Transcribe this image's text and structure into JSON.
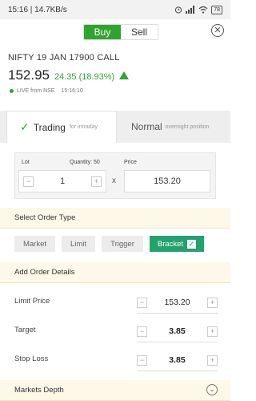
{
  "status_bar": {
    "time_speed": "15:16 | 14.7KB/s",
    "battery": "78"
  },
  "toggle": {
    "buy_label": "Buy",
    "sell_label": "Sell"
  },
  "instrument": {
    "name": "NIFTY 19 JAN 17900 CALL",
    "ltp": "152.95",
    "change": "24.35 (18.93%)",
    "live_label": "LIVE from NSE",
    "live_time": "15:16:10",
    "change_color": "#2fa52f"
  },
  "tabs": {
    "trading": {
      "title": "Trading",
      "sub": "for intraday"
    },
    "normal": {
      "title": "Normal",
      "sub": "overnight position"
    }
  },
  "order": {
    "lot_label": "Lot",
    "quantity_label": "Quantity: 50",
    "price_label": "Price",
    "lot_value": "1",
    "price_value": "153.20",
    "times": "x"
  },
  "order_type": {
    "heading": "Select Order Type",
    "options": [
      "Market",
      "Limit",
      "Trigger",
      "Bracket"
    ],
    "selected": "Bracket",
    "accent_color": "#23a26e"
  },
  "details": {
    "heading": "Add Order Details",
    "limit_price": {
      "label": "Limit Price",
      "value": "153.20"
    },
    "target": {
      "label": "Target",
      "value": "3.85"
    },
    "stop_loss": {
      "label": "Stop Loss",
      "value": "3.85"
    }
  },
  "markets_depth": {
    "heading": "Markets Depth"
  },
  "icons": {
    "close": "close-icon",
    "check": "check-icon",
    "chevron": "chevron-down-icon",
    "arrow": "arrow-up-icon"
  }
}
